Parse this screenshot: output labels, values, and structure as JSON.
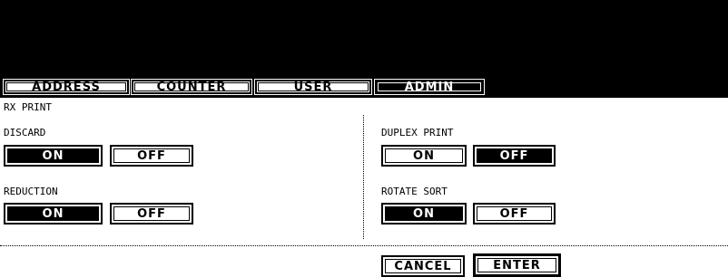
{
  "tabs": [
    {
      "label": "ADDRESS",
      "active": false
    },
    {
      "label": "COUNTER",
      "active": false
    },
    {
      "label": "USER",
      "active": false
    },
    {
      "label": "ADMIN",
      "active": true
    }
  ],
  "section_title": "RX PRINT",
  "discard": {
    "label": "DISCARD",
    "on": "ON",
    "off": "OFF",
    "selected": "ON"
  },
  "reduction": {
    "label": "REDUCTION",
    "on": "ON",
    "off": "OFF",
    "selected": "ON"
  },
  "duplex_print": {
    "label": "DUPLEX PRINT",
    "on": "ON",
    "off": "OFF",
    "selected": "OFF"
  },
  "rotate_sort": {
    "label": "ROTATE SORT",
    "on": "ON",
    "off": "OFF",
    "selected": "ON"
  },
  "actions": {
    "cancel": "CANCEL",
    "enter": "ENTER"
  }
}
